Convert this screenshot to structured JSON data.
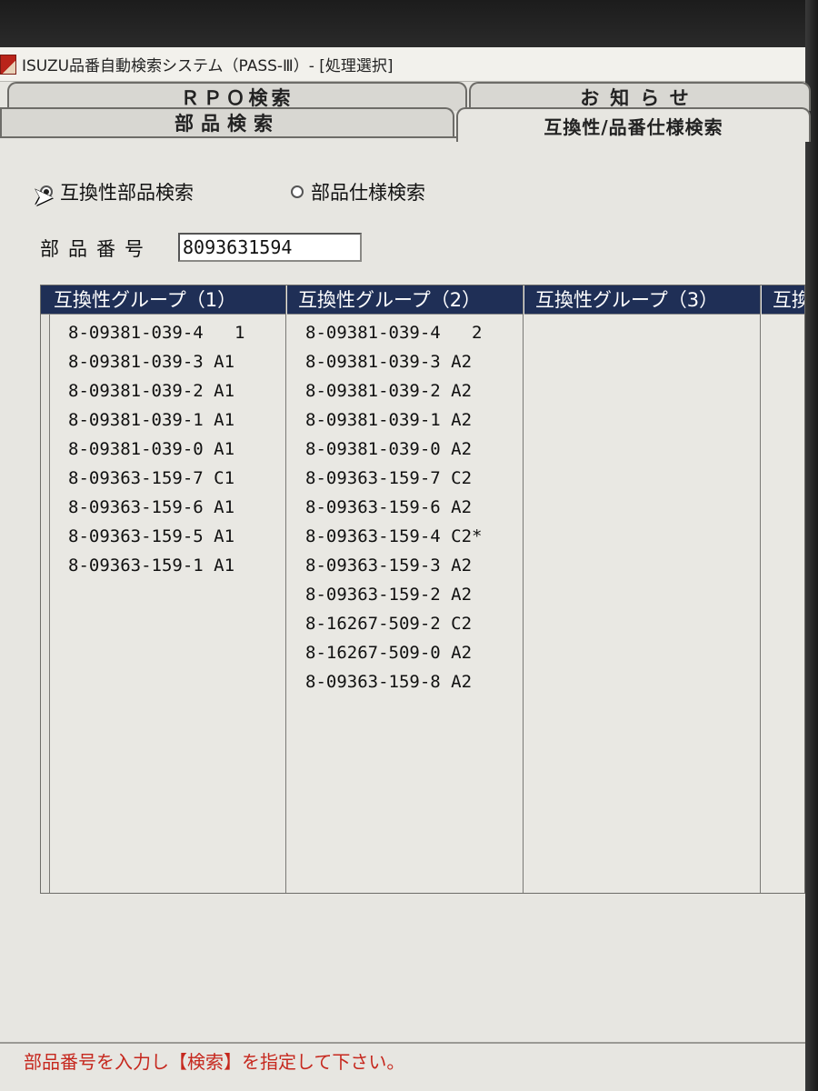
{
  "window": {
    "title": "ISUZU品番自動検索システム（PASS-Ⅲ）- [処理選択]"
  },
  "tabs": {
    "rpo": "ＲＰＯ検索",
    "notice": "お知らせ",
    "parts": "部品検索",
    "compat": "互換性/品番仕様検索"
  },
  "search_mode": {
    "compat_label": "互換性部品検索",
    "spec_label": "部品仕様検索",
    "selected": "compat"
  },
  "part_number": {
    "label": "部品番号",
    "value": "8093631594"
  },
  "groups": [
    {
      "header": "互換性グループ（1）",
      "rows": [
        "8-09381-039-4   1",
        "8-09381-039-3 A1",
        "8-09381-039-2 A1",
        "8-09381-039-1 A1",
        "8-09381-039-0 A1",
        "8-09363-159-7 C1",
        "8-09363-159-6 A1",
        "8-09363-159-5 A1",
        "8-09363-159-1 A1"
      ]
    },
    {
      "header": "互換性グループ（2）",
      "rows": [
        "8-09381-039-4   2",
        "8-09381-039-3 A2",
        "8-09381-039-2 A2",
        "8-09381-039-1 A2",
        "8-09381-039-0 A2",
        "8-09363-159-7 C2",
        "8-09363-159-6 A2",
        "8-09363-159-4 C2*",
        "8-09363-159-3 A2",
        "8-09363-159-2 A2",
        "8-16267-509-2 C2",
        "8-16267-509-0 A2",
        "8-09363-159-8 A2"
      ]
    },
    {
      "header": "互換性グループ（3）",
      "rows": []
    },
    {
      "header": "互換",
      "rows": []
    }
  ],
  "status": {
    "message": "部品番号を入力し【検索】を指定して下さい。",
    "color": "#c6281e"
  },
  "colors": {
    "header_bg": "#1f2f56",
    "window_bg": "#e7e6e1"
  }
}
